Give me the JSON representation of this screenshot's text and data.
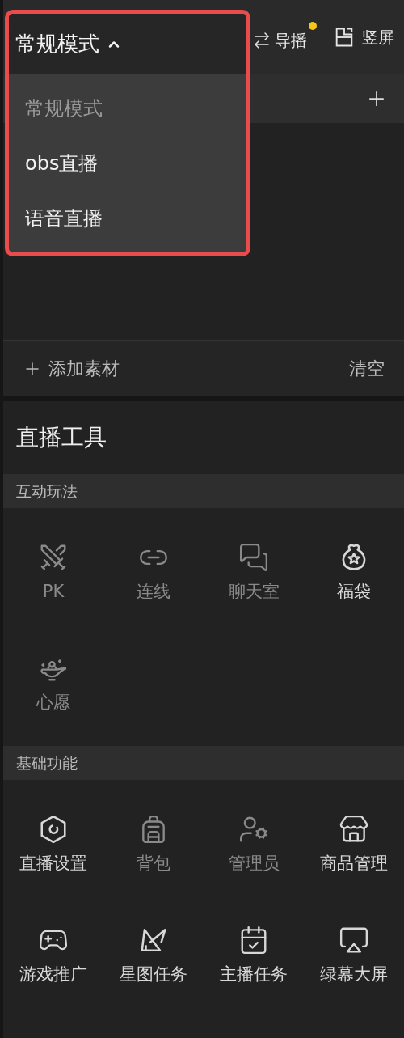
{
  "mode_dropdown": {
    "label": "常规模式",
    "expanded": true,
    "options": [
      {
        "label": "常规模式",
        "selected": true
      },
      {
        "label": "obs直播",
        "selected": false
      },
      {
        "label": "语音直播",
        "selected": false
      }
    ]
  },
  "top_bar": {
    "director": {
      "label": "导播",
      "notification": true
    },
    "orientation": {
      "label": "竖屏"
    }
  },
  "material_bar": {
    "add": "添加素材",
    "clear": "清空"
  },
  "tools": {
    "title": "直播工具",
    "sections": [
      {
        "title": "互动玩法",
        "items": [
          {
            "kind": "pk",
            "label": "PK",
            "disabled": true
          },
          {
            "kind": "link",
            "label": "连线",
            "disabled": true
          },
          {
            "kind": "chat",
            "label": "聊天室",
            "disabled": true
          },
          {
            "kind": "bag",
            "label": "福袋",
            "disabled": false
          },
          {
            "kind": "lamp",
            "label": "心愿",
            "disabled": true
          }
        ]
      },
      {
        "title": "基础功能",
        "items": [
          {
            "kind": "settings",
            "label": "直播设置",
            "disabled": false
          },
          {
            "kind": "backpack",
            "label": "背包",
            "disabled": true
          },
          {
            "kind": "admin",
            "label": "管理员",
            "disabled": true
          },
          {
            "kind": "store",
            "label": "商品管理",
            "disabled": false
          },
          {
            "kind": "gamepad",
            "label": "游戏推广",
            "disabled": false
          },
          {
            "kind": "triangle",
            "label": "星图任务",
            "disabled": false
          },
          {
            "kind": "calendar",
            "label": "主播任务",
            "disabled": false
          },
          {
            "kind": "screen",
            "label": "绿幕大屏",
            "disabled": false
          }
        ]
      }
    ]
  }
}
